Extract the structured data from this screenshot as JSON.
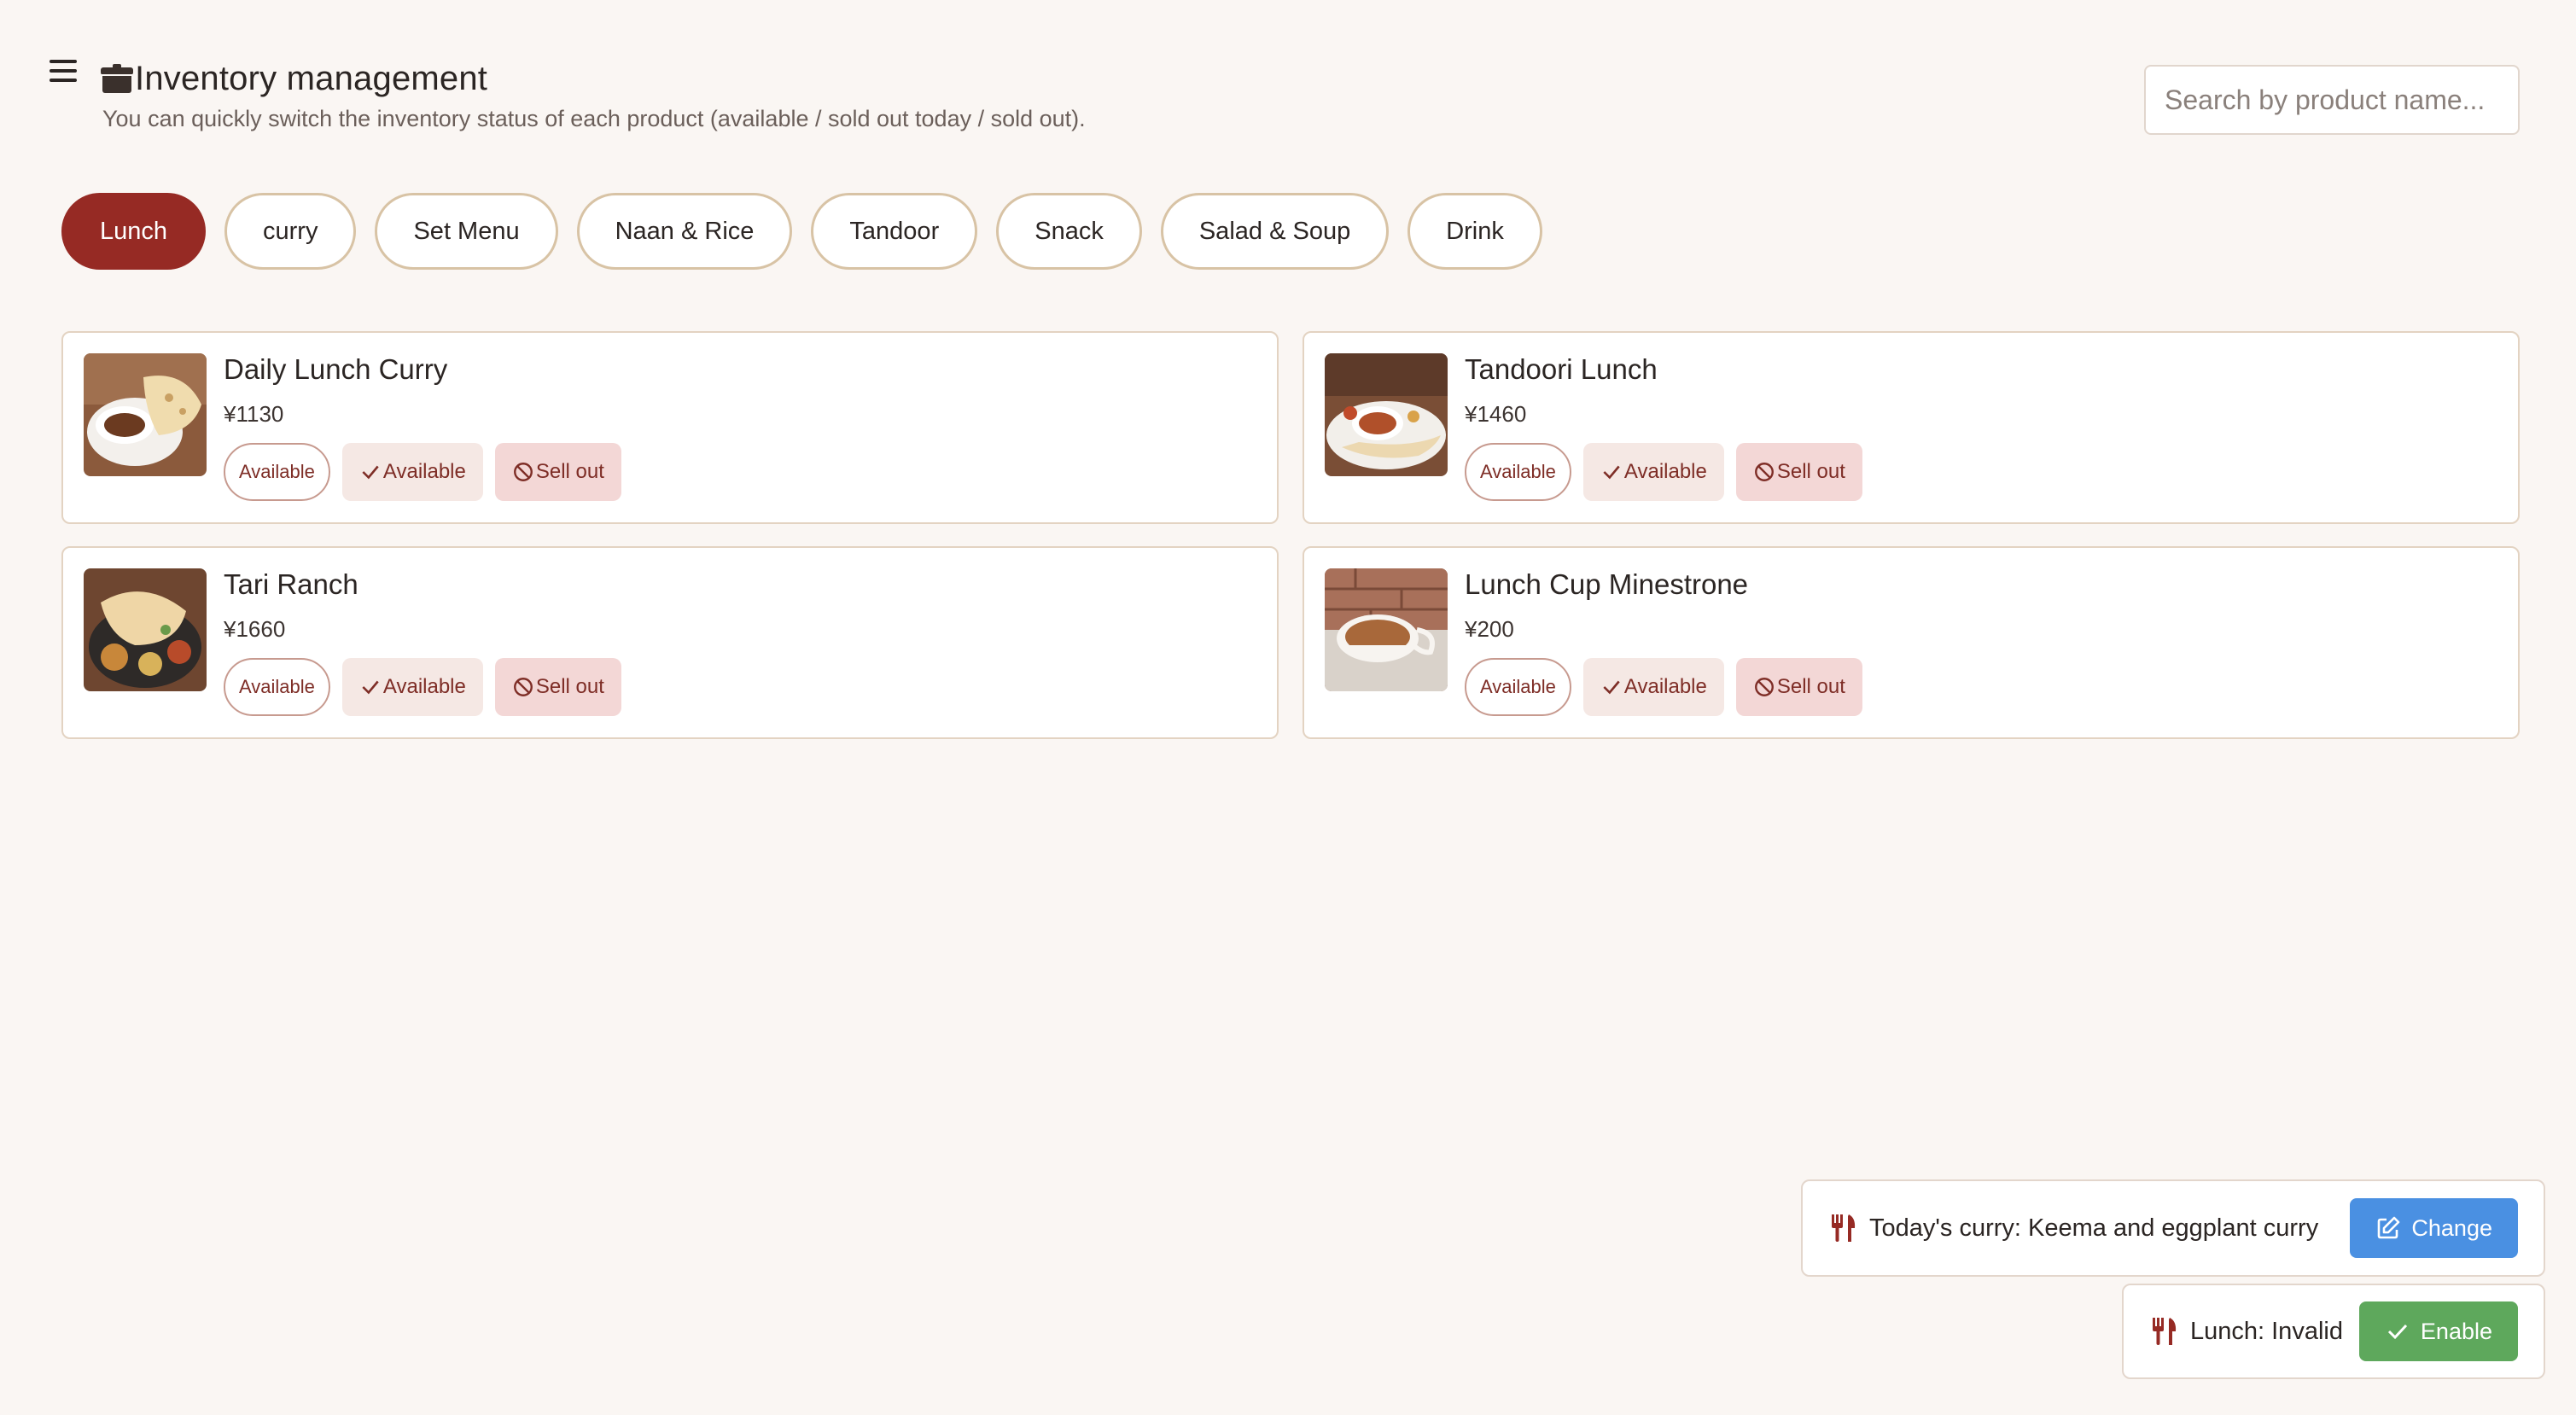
{
  "header": {
    "title": "Inventory management",
    "subtitle": "You can quickly switch the inventory status of each product (available / sold out today / sold out).",
    "title_icon": "box-icon",
    "menu_icon": "hamburger-menu-icon"
  },
  "search": {
    "placeholder": "Search by product name..."
  },
  "tabs": [
    {
      "label": "Lunch",
      "active": true
    },
    {
      "label": "curry"
    },
    {
      "label": "Set Menu"
    },
    {
      "label": "Naan & Rice"
    },
    {
      "label": "Tandoor"
    },
    {
      "label": "Snack"
    },
    {
      "label": "Salad & Soup"
    },
    {
      "label": "Drink"
    }
  ],
  "products": [
    {
      "name": "Daily Lunch Curry",
      "price": "¥1130",
      "status": "Available",
      "available_label": "Available",
      "sellout_label": "Sell out"
    },
    {
      "name": "Tandoori Lunch",
      "price": "¥1460",
      "status": "Available",
      "available_label": "Available",
      "sellout_label": "Sell out"
    },
    {
      "name": "Tari Ranch",
      "price": "¥1660",
      "status": "Available",
      "available_label": "Available",
      "sellout_label": "Sell out"
    },
    {
      "name": "Lunch Cup Minestrone",
      "price": "¥200",
      "status": "Available",
      "available_label": "Available",
      "sellout_label": "Sell out"
    }
  ],
  "panels": {
    "curry": {
      "text": "Today's curry: Keema and eggplant curry",
      "button": "Change"
    },
    "lunch": {
      "text": "Lunch: Invalid",
      "button": "Enable"
    }
  },
  "colors": {
    "accent": "#962a24",
    "background": "#faf6f3",
    "change_button": "#4a90e2",
    "enable_button": "#5ea85c"
  }
}
